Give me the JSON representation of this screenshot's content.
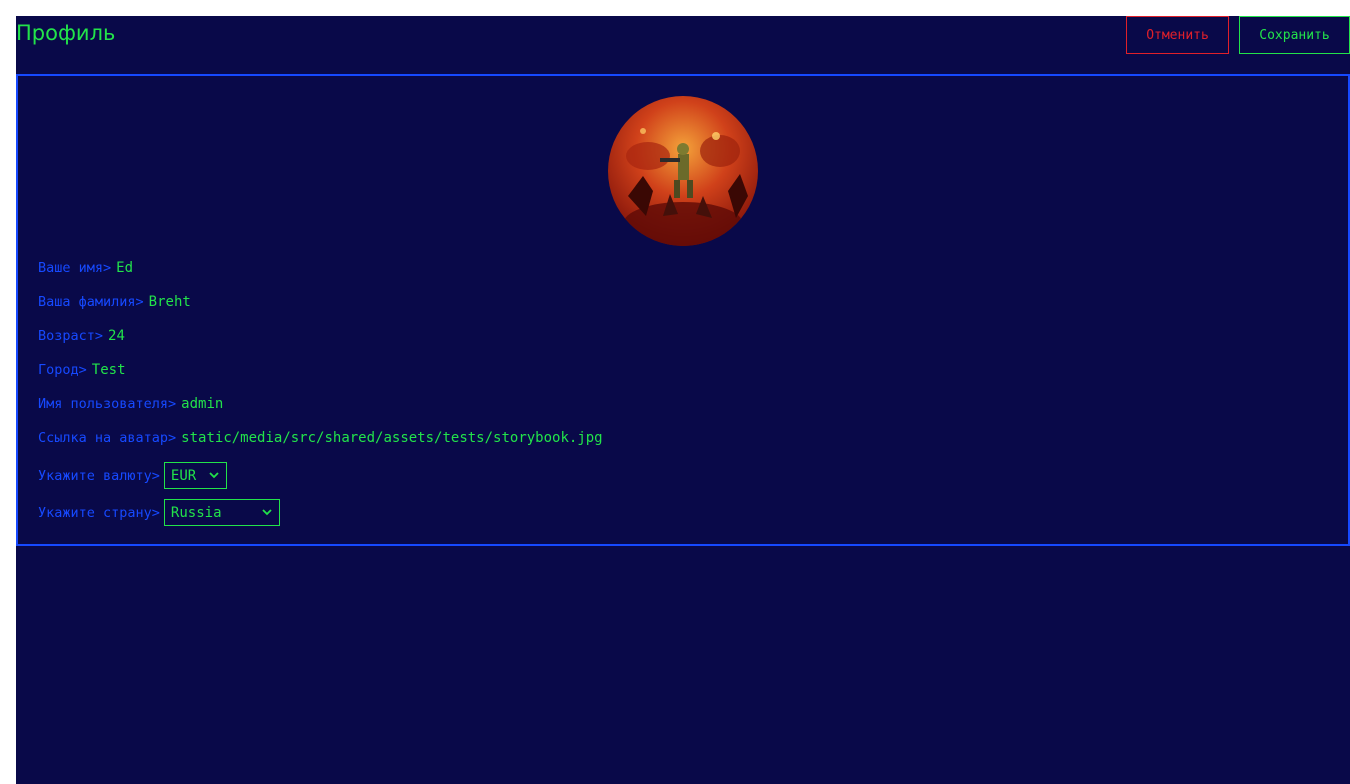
{
  "header": {
    "title": "Профиль",
    "cancel_label": "Отменить",
    "save_label": "Сохранить"
  },
  "profile": {
    "avatar_alt": "avatar",
    "fields": [
      {
        "label": "Ваше имя>",
        "value": "Ed"
      },
      {
        "label": "Ваша фамилия>",
        "value": "Breht"
      },
      {
        "label": "Возраст>",
        "value": "24"
      },
      {
        "label": "Город>",
        "value": "Test"
      },
      {
        "label": "Имя пользователя>",
        "value": "admin"
      },
      {
        "label": "Ссылка на аватар>",
        "value": "static/media/src/shared/assets/tests/storybook.jpg"
      }
    ],
    "currency": {
      "label": "Укажите валюту>",
      "selected": "EUR"
    },
    "country": {
      "label": "Укажите страну>",
      "selected": "Russia"
    }
  },
  "colors": {
    "background": "#090949",
    "accent_green": "#22e34a",
    "label_blue": "#1649ff",
    "cancel_red": "#e0202a"
  },
  "icons": {
    "select_arrow": "chevron-down-icon"
  }
}
